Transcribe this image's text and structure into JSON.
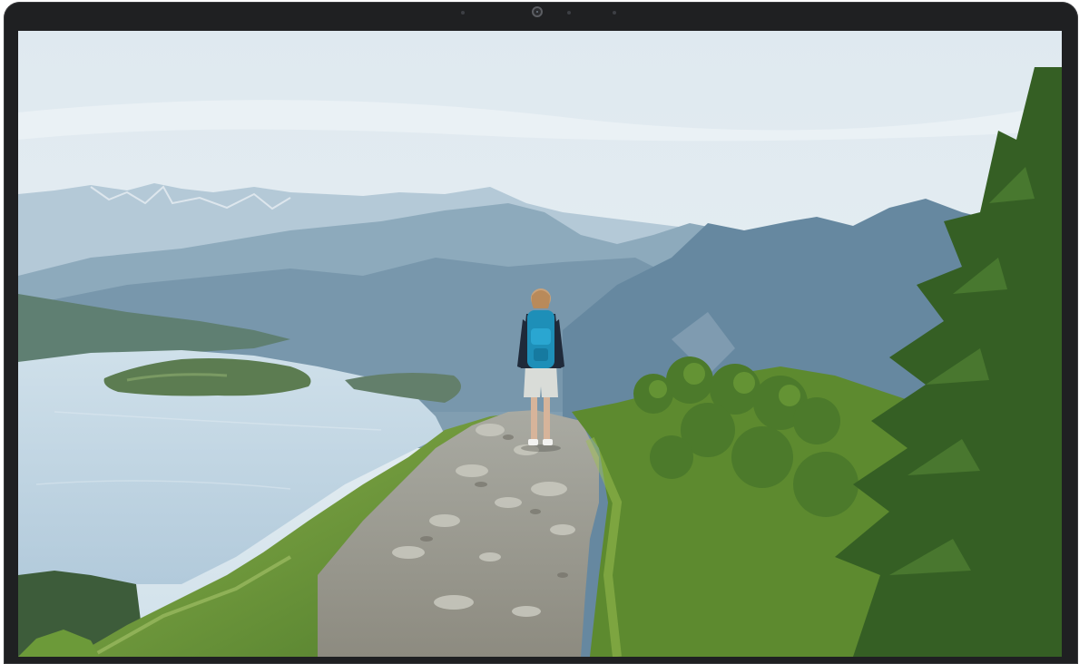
{
  "device": {
    "type": "laptop-display",
    "bezel_color": "#1f2022",
    "webcam_icon": "webcam-icon",
    "sensor_icons": [
      "sensor-dot-icon",
      "sensor-dot-icon",
      "sensor-dot-icon"
    ]
  },
  "wallpaper": {
    "scene": "hiker-on-alpine-ridge-above-lake",
    "colors": {
      "sky_top": "#dfe9f0",
      "sky_bottom": "#cfe0ea",
      "far_mountains": "#a8c2d4",
      "mid_mountains": "#7d9db3",
      "near_mountains": "#5e8199",
      "lake": "#b9d1df",
      "grass": "#6f9a3b",
      "tree": "#3f6a2a",
      "backpack": "#1e8fb8"
    }
  }
}
